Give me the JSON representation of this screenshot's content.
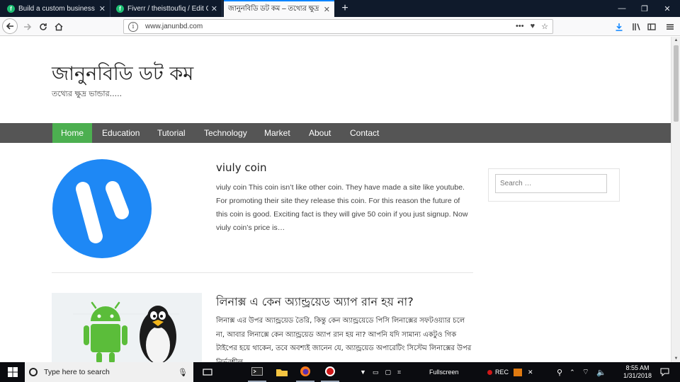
{
  "browser": {
    "tabs": [
      {
        "favicon": "f",
        "title": "Build a custom business wordp"
      },
      {
        "favicon": "f",
        "title": "Fiverr / theisttoufiq / Edit Gig"
      },
      {
        "favicon": "",
        "title": "জানুনবিডি ডট কম – তথ্যের ক্ষুদ্র ভা"
      }
    ],
    "url": "www.janunbd.com"
  },
  "site": {
    "title": "জানুনবিডি ডট কম",
    "description": "তথ্যের ক্ষুদ্র ভান্ডার....."
  },
  "menu": [
    "Home",
    "Education",
    "Tutorial",
    "Technology",
    "Market",
    "About",
    "Contact"
  ],
  "posts": [
    {
      "title": "viuly coin",
      "excerpt": "viuly coin This coin isn’t like other coin. They have made a site like youtube. For promoting their site they release this coin. For this reason the future of this coin is good. Exciting fact is they will give 50 coin if you just signup. Now viuly coin’s price is…"
    },
    {
      "title": "লিনাক্স এ কেন অ্যান্ড্রয়েড অ্যাপ রান হয় না?",
      "excerpt": "লিনাক্স এর উপর অ্যান্ড্রয়েড তৈরি, কিন্তু কেন অ্যান্ড্রয়েডে পিসি লিনাক্সের সফটওয়্যার চলে না, আবার লিনাক্সে কেন অ্যান্ড্রয়েড অ্যাপ রান হয় না? আপনি যদি সামান্য একটুও গিক টাইপের হয়ে থাকেন, তবে অবশ্যই জানেন যে, অ্যান্ড্রয়েড অপারেটিং সিস্টেম লিনাক্সের উপর নির্ভরশীল"
    }
  ],
  "search": {
    "placeholder": "Search …"
  },
  "taskbar": {
    "search_placeholder": "Type here to search",
    "fullscreen_label": "Fullscreen",
    "rec_label": "REC",
    "time": "8:55 AM",
    "date": "1/31/2018"
  },
  "colors": {
    "menu_bg": "#555555",
    "menu_active": "#4caf50",
    "viuly_blue": "#1e88f5"
  }
}
